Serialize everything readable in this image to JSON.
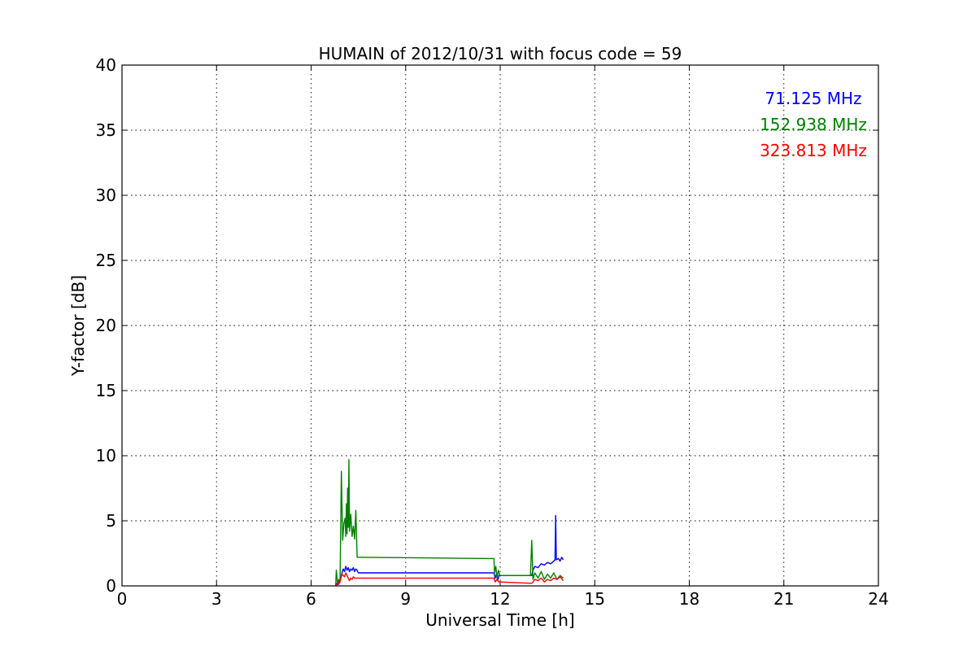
{
  "chart_data": {
    "type": "line",
    "title": "HUMAIN of 2012/10/31 with focus code = 59",
    "xlabel": "Universal Time [h]",
    "ylabel": "Y-factor [dB]",
    "xlim": [
      0,
      24
    ],
    "ylim": [
      0,
      40
    ],
    "xticks": [
      0,
      3,
      6,
      9,
      12,
      15,
      18,
      21,
      24
    ],
    "yticks": [
      0,
      5,
      10,
      15,
      20,
      25,
      30,
      35,
      40
    ],
    "xtick_labels": [
      "0",
      "3",
      "6",
      "9",
      "12",
      "15",
      "18",
      "21",
      "24"
    ],
    "ytick_labels": [
      "0",
      "5",
      "10",
      "15",
      "20",
      "25",
      "30",
      "35",
      "40"
    ],
    "grid": true,
    "legend_position": "top-right",
    "series": [
      {
        "name": "71.125 MHz",
        "color": "#0000ff",
        "points": [
          [
            6.78,
            0.0
          ],
          [
            6.82,
            0.2
          ],
          [
            6.86,
            0.1
          ],
          [
            6.9,
            0.4
          ],
          [
            6.94,
            0.6
          ],
          [
            6.98,
            1.0
          ],
          [
            7.02,
            1.3
          ],
          [
            7.06,
            1.1
          ],
          [
            7.1,
            1.5
          ],
          [
            7.14,
            1.2
          ],
          [
            7.18,
            1.4
          ],
          [
            7.22,
            1.1
          ],
          [
            7.26,
            1.3
          ],
          [
            7.3,
            1.2
          ],
          [
            7.34,
            1.4
          ],
          [
            7.38,
            1.1
          ],
          [
            7.42,
            1.3
          ],
          [
            7.46,
            1.2
          ],
          [
            7.5,
            1.0
          ],
          [
            11.8,
            1.0
          ],
          [
            11.84,
            0.6
          ],
          [
            11.88,
            0.9
          ],
          [
            11.92,
            0.4
          ],
          [
            11.96,
            0.8
          ],
          [
            12.0,
            0.8
          ],
          [
            13.0,
            0.8
          ],
          [
            13.04,
            1.2
          ],
          [
            13.1,
            1.5
          ],
          [
            13.2,
            1.4
          ],
          [
            13.3,
            1.7
          ],
          [
            13.4,
            1.6
          ],
          [
            13.5,
            1.8
          ],
          [
            13.6,
            1.7
          ],
          [
            13.7,
            1.9
          ],
          [
            13.74,
            2.0
          ],
          [
            13.76,
            5.4
          ],
          [
            13.78,
            2.0
          ],
          [
            13.85,
            2.1
          ],
          [
            13.9,
            1.9
          ],
          [
            13.95,
            2.2
          ],
          [
            14.0,
            2.0
          ]
        ]
      },
      {
        "name": "152.938 MHz",
        "color": "#008000",
        "points": [
          [
            6.78,
            0.0
          ],
          [
            6.8,
            1.2
          ],
          [
            6.84,
            0.2
          ],
          [
            6.88,
            0.5
          ],
          [
            6.92,
            0.3
          ],
          [
            6.96,
            8.8
          ],
          [
            7.0,
            3.5
          ],
          [
            7.04,
            4.8
          ],
          [
            7.08,
            5.2
          ],
          [
            7.1,
            3.8
          ],
          [
            7.12,
            6.3
          ],
          [
            7.14,
            4.0
          ],
          [
            7.16,
            7.5
          ],
          [
            7.18,
            4.5
          ],
          [
            7.2,
            9.7
          ],
          [
            7.22,
            4.2
          ],
          [
            7.26,
            5.5
          ],
          [
            7.3,
            3.8
          ],
          [
            7.34,
            4.6
          ],
          [
            7.38,
            3.6
          ],
          [
            7.42,
            5.8
          ],
          [
            7.46,
            2.2
          ],
          [
            7.5,
            2.2
          ],
          [
            11.8,
            2.1
          ],
          [
            11.82,
            1.0
          ],
          [
            11.86,
            1.5
          ],
          [
            11.9,
            0.6
          ],
          [
            11.94,
            1.2
          ],
          [
            11.98,
            0.9
          ],
          [
            12.0,
            0.8
          ],
          [
            12.96,
            0.8
          ],
          [
            13.0,
            3.5
          ],
          [
            13.04,
            0.5
          ],
          [
            13.1,
            1.0
          ],
          [
            13.2,
            0.6
          ],
          [
            13.3,
            1.1
          ],
          [
            13.4,
            0.5
          ],
          [
            13.5,
            0.9
          ],
          [
            13.6,
            0.6
          ],
          [
            13.7,
            1.0
          ],
          [
            13.8,
            0.5
          ],
          [
            13.9,
            0.8
          ],
          [
            14.0,
            0.6
          ]
        ]
      },
      {
        "name": "323.813 MHz",
        "color": "#ff0000",
        "points": [
          [
            6.78,
            0.0
          ],
          [
            6.82,
            0.1
          ],
          [
            6.86,
            0.3
          ],
          [
            6.9,
            0.2
          ],
          [
            6.94,
            0.5
          ],
          [
            6.98,
            0.9
          ],
          [
            7.02,
            0.8
          ],
          [
            7.06,
            0.7
          ],
          [
            7.1,
            1.0
          ],
          [
            7.14,
            0.8
          ],
          [
            7.18,
            0.6
          ],
          [
            7.22,
            0.4
          ],
          [
            7.26,
            0.6
          ],
          [
            7.3,
            0.5
          ],
          [
            7.34,
            0.7
          ],
          [
            7.38,
            0.6
          ],
          [
            7.42,
            0.6
          ],
          [
            7.46,
            0.6
          ],
          [
            7.5,
            0.6
          ],
          [
            11.8,
            0.6
          ],
          [
            11.84,
            0.3
          ],
          [
            11.9,
            0.5
          ],
          [
            11.96,
            0.3
          ],
          [
            12.0,
            0.3
          ],
          [
            13.0,
            0.2
          ],
          [
            13.04,
            0.3
          ],
          [
            13.1,
            0.5
          ],
          [
            13.2,
            0.4
          ],
          [
            13.3,
            0.6
          ],
          [
            13.4,
            0.3
          ],
          [
            13.5,
            0.5
          ],
          [
            13.6,
            0.4
          ],
          [
            13.7,
            0.6
          ],
          [
            13.8,
            0.5
          ],
          [
            13.9,
            0.7
          ],
          [
            14.0,
            0.4
          ]
        ]
      }
    ]
  }
}
